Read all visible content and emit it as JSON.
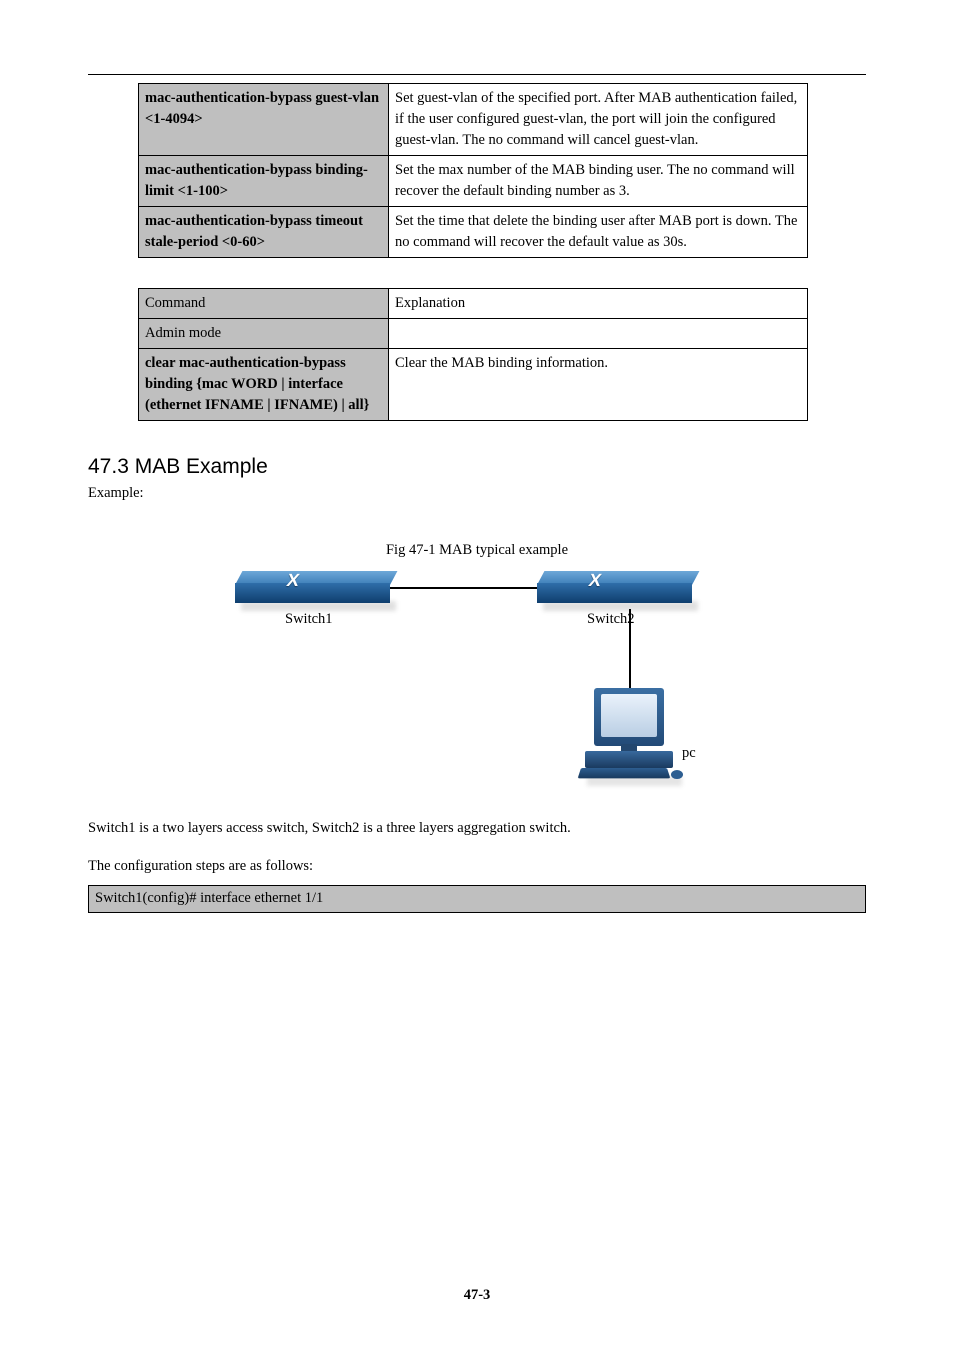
{
  "table1": {
    "rows": [
      {
        "left": "mac-authentication-bypass guest-vlan <1-4094>",
        "right": "Set guest-vlan of the specified port. After MAB authentication failed, if the user configured guest-vlan, the port will join the configured guest-vlan. The no command will cancel guest-vlan."
      },
      {
        "left": "mac-authentication-bypass binding-limit <1-100>",
        "right": "Set the max number of the MAB binding user. The no command will recover the default binding number as 3."
      },
      {
        "left": "mac-authentication-bypass timeout stale-period <0-60>",
        "right": "Set the time that delete the binding user after MAB port is down. The no command will recover the default value as 30s."
      }
    ]
  },
  "inner_table_heading": {
    "col1": "Command",
    "col2": "Explanation"
  },
  "inner_table_mode": {
    "col1": "Admin mode",
    "col2": ""
  },
  "table2": {
    "rows": [
      {
        "left": "clear mac-authentication-bypass binding {mac WORD | interface (ethernet IFNAME | IFNAME) | all}",
        "right": "Clear the MAB binding information."
      }
    ]
  },
  "section_heading": "47.3 MAB Example",
  "example_label": "Example:",
  "figure_caption": "Fig 47-1 MAB typical example",
  "diagram": {
    "switch1_label": "Switch1",
    "switch2_label": "Switch2",
    "pc_label": "pc"
  },
  "body_paragraph": "Switch1 is a two layers access switch, Switch2 is a three layers aggregation switch.",
  "config_steps_label": "The configuration steps are as follows:",
  "code_line1": "Switch1(config)# interface ethernet 1/1",
  "page_number": "47-3"
}
